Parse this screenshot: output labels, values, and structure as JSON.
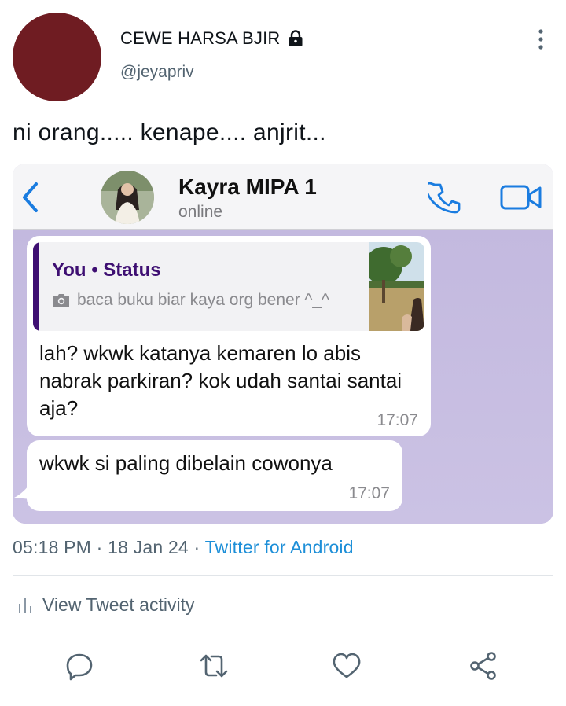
{
  "author": {
    "display_name": "CEWE HARSA BJIR",
    "handle": "@jeyapriv",
    "avatar_color": "#6f1c22",
    "protected_icon": "lock-icon"
  },
  "tweet": {
    "text": "ni orang..... kenape.... anjrit..."
  },
  "screenshot": {
    "back_icon": "chevron-left-icon",
    "contact_name": "Kayra MIPA 1",
    "contact_status": "online",
    "actions": [
      "phone-icon",
      "video-camera-icon"
    ],
    "accent_color": "#1a7ce0",
    "chat_background": "#c3b9df",
    "messages": [
      {
        "quote": {
          "author": "You • Status",
          "text": "baca buku biar kaya org bener ^_^",
          "icon": "camera-icon",
          "quote_color": "#3e0f72"
        },
        "text": "lah? wkwk katanya kemaren lo abis nabrak parkiran? kok udah santai santai aja?",
        "time": "17:07"
      },
      {
        "text": "wkwk si paling dibelain cowonya",
        "time": "17:07"
      }
    ]
  },
  "meta": {
    "time": "05:18 PM",
    "separator": "·",
    "date": "18 Jan 24",
    "source": "Twitter for Android",
    "source_color": "#1d8fd8"
  },
  "activity": {
    "label": "View Tweet activity",
    "icon": "bar-chart-icon"
  },
  "actions": [
    "reply-icon",
    "retweet-icon",
    "like-icon",
    "share-icon"
  ]
}
